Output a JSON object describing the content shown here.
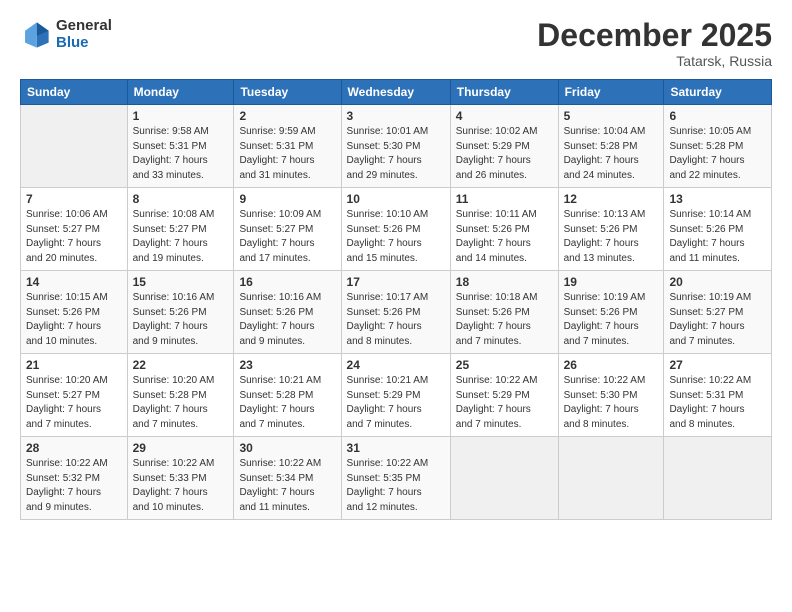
{
  "logo": {
    "general": "General",
    "blue": "Blue"
  },
  "title": "December 2025",
  "location": "Tatarsk, Russia",
  "days_header": [
    "Sunday",
    "Monday",
    "Tuesday",
    "Wednesday",
    "Thursday",
    "Friday",
    "Saturday"
  ],
  "weeks": [
    [
      {
        "num": "",
        "info": ""
      },
      {
        "num": "1",
        "info": "Sunrise: 9:58 AM\nSunset: 5:31 PM\nDaylight: 7 hours\nand 33 minutes."
      },
      {
        "num": "2",
        "info": "Sunrise: 9:59 AM\nSunset: 5:31 PM\nDaylight: 7 hours\nand 31 minutes."
      },
      {
        "num": "3",
        "info": "Sunrise: 10:01 AM\nSunset: 5:30 PM\nDaylight: 7 hours\nand 29 minutes."
      },
      {
        "num": "4",
        "info": "Sunrise: 10:02 AM\nSunset: 5:29 PM\nDaylight: 7 hours\nand 26 minutes."
      },
      {
        "num": "5",
        "info": "Sunrise: 10:04 AM\nSunset: 5:28 PM\nDaylight: 7 hours\nand 24 minutes."
      },
      {
        "num": "6",
        "info": "Sunrise: 10:05 AM\nSunset: 5:28 PM\nDaylight: 7 hours\nand 22 minutes."
      }
    ],
    [
      {
        "num": "7",
        "info": "Sunrise: 10:06 AM\nSunset: 5:27 PM\nDaylight: 7 hours\nand 20 minutes."
      },
      {
        "num": "8",
        "info": "Sunrise: 10:08 AM\nSunset: 5:27 PM\nDaylight: 7 hours\nand 19 minutes."
      },
      {
        "num": "9",
        "info": "Sunrise: 10:09 AM\nSunset: 5:27 PM\nDaylight: 7 hours\nand 17 minutes."
      },
      {
        "num": "10",
        "info": "Sunrise: 10:10 AM\nSunset: 5:26 PM\nDaylight: 7 hours\nand 15 minutes."
      },
      {
        "num": "11",
        "info": "Sunrise: 10:11 AM\nSunset: 5:26 PM\nDaylight: 7 hours\nand 14 minutes."
      },
      {
        "num": "12",
        "info": "Sunrise: 10:13 AM\nSunset: 5:26 PM\nDaylight: 7 hours\nand 13 minutes."
      },
      {
        "num": "13",
        "info": "Sunrise: 10:14 AM\nSunset: 5:26 PM\nDaylight: 7 hours\nand 11 minutes."
      }
    ],
    [
      {
        "num": "14",
        "info": "Sunrise: 10:15 AM\nSunset: 5:26 PM\nDaylight: 7 hours\nand 10 minutes."
      },
      {
        "num": "15",
        "info": "Sunrise: 10:16 AM\nSunset: 5:26 PM\nDaylight: 7 hours\nand 9 minutes."
      },
      {
        "num": "16",
        "info": "Sunrise: 10:16 AM\nSunset: 5:26 PM\nDaylight: 7 hours\nand 9 minutes."
      },
      {
        "num": "17",
        "info": "Sunrise: 10:17 AM\nSunset: 5:26 PM\nDaylight: 7 hours\nand 8 minutes."
      },
      {
        "num": "18",
        "info": "Sunrise: 10:18 AM\nSunset: 5:26 PM\nDaylight: 7 hours\nand 7 minutes."
      },
      {
        "num": "19",
        "info": "Sunrise: 10:19 AM\nSunset: 5:26 PM\nDaylight: 7 hours\nand 7 minutes."
      },
      {
        "num": "20",
        "info": "Sunrise: 10:19 AM\nSunset: 5:27 PM\nDaylight: 7 hours\nand 7 minutes."
      }
    ],
    [
      {
        "num": "21",
        "info": "Sunrise: 10:20 AM\nSunset: 5:27 PM\nDaylight: 7 hours\nand 7 minutes."
      },
      {
        "num": "22",
        "info": "Sunrise: 10:20 AM\nSunset: 5:28 PM\nDaylight: 7 hours\nand 7 minutes."
      },
      {
        "num": "23",
        "info": "Sunrise: 10:21 AM\nSunset: 5:28 PM\nDaylight: 7 hours\nand 7 minutes."
      },
      {
        "num": "24",
        "info": "Sunrise: 10:21 AM\nSunset: 5:29 PM\nDaylight: 7 hours\nand 7 minutes."
      },
      {
        "num": "25",
        "info": "Sunrise: 10:22 AM\nSunset: 5:29 PM\nDaylight: 7 hours\nand 7 minutes."
      },
      {
        "num": "26",
        "info": "Sunrise: 10:22 AM\nSunset: 5:30 PM\nDaylight: 7 hours\nand 8 minutes."
      },
      {
        "num": "27",
        "info": "Sunrise: 10:22 AM\nSunset: 5:31 PM\nDaylight: 7 hours\nand 8 minutes."
      }
    ],
    [
      {
        "num": "28",
        "info": "Sunrise: 10:22 AM\nSunset: 5:32 PM\nDaylight: 7 hours\nand 9 minutes."
      },
      {
        "num": "29",
        "info": "Sunrise: 10:22 AM\nSunset: 5:33 PM\nDaylight: 7 hours\nand 10 minutes."
      },
      {
        "num": "30",
        "info": "Sunrise: 10:22 AM\nSunset: 5:34 PM\nDaylight: 7 hours\nand 11 minutes."
      },
      {
        "num": "31",
        "info": "Sunrise: 10:22 AM\nSunset: 5:35 PM\nDaylight: 7 hours\nand 12 minutes."
      },
      {
        "num": "",
        "info": ""
      },
      {
        "num": "",
        "info": ""
      },
      {
        "num": "",
        "info": ""
      }
    ]
  ]
}
